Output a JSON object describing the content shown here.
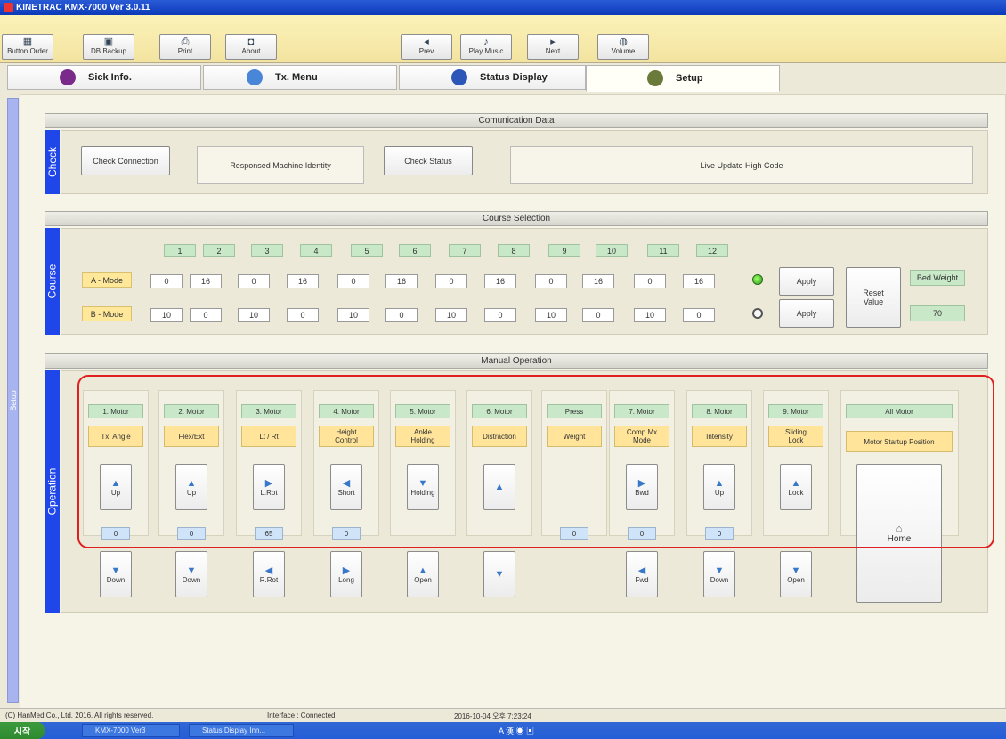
{
  "window": {
    "title": "KINETRAC   KMX-7000   Ver 3.0.11"
  },
  "toolbar": [
    {
      "id": "button-order",
      "label": "Button Order",
      "icon": "grid-icon",
      "glyph": "▦"
    },
    {
      "id": "db-backup",
      "label": "DB Backup",
      "icon": "database-icon",
      "glyph": "▣"
    },
    {
      "id": "print",
      "label": "Print",
      "icon": "printer-icon",
      "glyph": "⎙"
    },
    {
      "id": "about",
      "label": "About",
      "icon": "info-icon",
      "glyph": "◘"
    },
    {
      "id": "prev",
      "label": "Prev",
      "icon": "prev-icon",
      "glyph": "◂"
    },
    {
      "id": "play-music",
      "label": "Play Music",
      "icon": "music-icon",
      "glyph": "♪"
    },
    {
      "id": "next",
      "label": "Next",
      "icon": "next-icon",
      "glyph": "▸"
    },
    {
      "id": "volume",
      "label": "Volume",
      "icon": "speaker-icon",
      "glyph": "◍"
    }
  ],
  "tabs": [
    {
      "label": "Sick Info.",
      "icon": "person-icon",
      "color": "#7a2a8a"
    },
    {
      "label": "Tx. Menu",
      "icon": "monitor-icon",
      "color": "#4a86d8"
    },
    {
      "label": "Status Display",
      "icon": "globe-icon",
      "color": "#2c56b8"
    },
    {
      "label": "Setup",
      "icon": "tools-icon",
      "color": "#6a7a3a"
    }
  ],
  "side_rail": "Setup",
  "check": {
    "rail": "Check",
    "header": "Comunication Data",
    "check_connection": "Check Connection",
    "responsed_identity": "Responsed Machine Identity",
    "check_status": "Check Status",
    "live_update": "Live Update High Code"
  },
  "course": {
    "rail": "Course",
    "header": "Course Selection",
    "numbers": [
      "1",
      "2",
      "3",
      "4",
      "5",
      "6",
      "7",
      "8",
      "9",
      "10",
      "11",
      "12"
    ],
    "a_mode_label": "A - Mode",
    "b_mode_label": "B - Mode",
    "a_values": [
      "0",
      "16",
      "0",
      "16",
      "0",
      "16",
      "0",
      "16",
      "0",
      "16",
      "0",
      "16"
    ],
    "b_values": [
      "10",
      "0",
      "10",
      "0",
      "10",
      "0",
      "10",
      "0",
      "10",
      "0",
      "10",
      "0"
    ],
    "apply_a": "Apply",
    "apply_b": "Apply",
    "reset_value": "Reset\nValue",
    "bed_weight_label": "Bed Weight",
    "bed_weight_value": "70"
  },
  "operation": {
    "rail": "Operation",
    "header": "Manual Operation",
    "columns": [
      {
        "motor": "1. Motor",
        "func": "Tx. Angle",
        "up": "Up",
        "up_glyph": "▲",
        "value": "0",
        "down": "Down",
        "down_glyph": "▼"
      },
      {
        "motor": "2. Motor",
        "func": "Flex/Ext",
        "up": "Up",
        "up_glyph": "▲",
        "value": "0",
        "down": "Down",
        "down_glyph": "▼"
      },
      {
        "motor": "3. Motor",
        "func": "Lt / Rt",
        "up": "L.Rot",
        "up_glyph": "▶",
        "value": "65",
        "down": "R.Rot",
        "down_glyph": "◀"
      },
      {
        "motor": "4. Motor",
        "func": "Height\nControl",
        "up": "Short",
        "up_glyph": "◀",
        "value": "0",
        "down": "Long",
        "down_glyph": "▶"
      },
      {
        "motor": "5. Motor",
        "func": "Ankle\nHolding",
        "up": "Holding",
        "up_glyph": "▼",
        "value": "",
        "down": "Open",
        "down_glyph": "▲"
      },
      {
        "motor": "6. Motor",
        "func": "Distraction",
        "up": "",
        "up_glyph": "▲",
        "value": "",
        "down": "",
        "down_glyph": "▼"
      },
      {
        "motor": "Press",
        "func": "Weight",
        "up": "",
        "up_glyph": "",
        "value": "0",
        "down": "",
        "down_glyph": ""
      },
      {
        "motor": "7. Motor",
        "func": "Comp Mx\nMode",
        "up": "Bwd",
        "up_glyph": "▶",
        "value": "0",
        "down": "Fwd",
        "down_glyph": "◀"
      },
      {
        "motor": "8. Motor",
        "func": "Intensity",
        "up": "Up",
        "up_glyph": "▲",
        "value": "0",
        "down": "Down",
        "down_glyph": "▼"
      },
      {
        "motor": "9. Motor",
        "func": "Sliding\nLock",
        "up": "Lock",
        "up_glyph": "▲",
        "value": "",
        "down": "Open",
        "down_glyph": "▼"
      }
    ],
    "all_motor": "All Motor",
    "startup_position": "Motor Startup Position",
    "home": "Home",
    "home_glyph": "⌂"
  },
  "statusbar": {
    "copyright": "(C) HanMed Co., Ltd.  2016. All rights reserved.",
    "interface": "Interface : Connected",
    "datetime": "2016-10-04 오후 7:23:24"
  },
  "taskbar": {
    "start": "시작",
    "tasks": [
      "KMX-7000 Ver3",
      "Status Display Inn..."
    ],
    "tray": "A 漢 ◉ ▣"
  },
  "colors": {
    "rail_blue": "#1f46e8",
    "motor_green": "#c9e8c9",
    "func_yellow": "#ffe49a",
    "value_blue": "#cfe4f9",
    "highlight_red": "#e02020"
  }
}
